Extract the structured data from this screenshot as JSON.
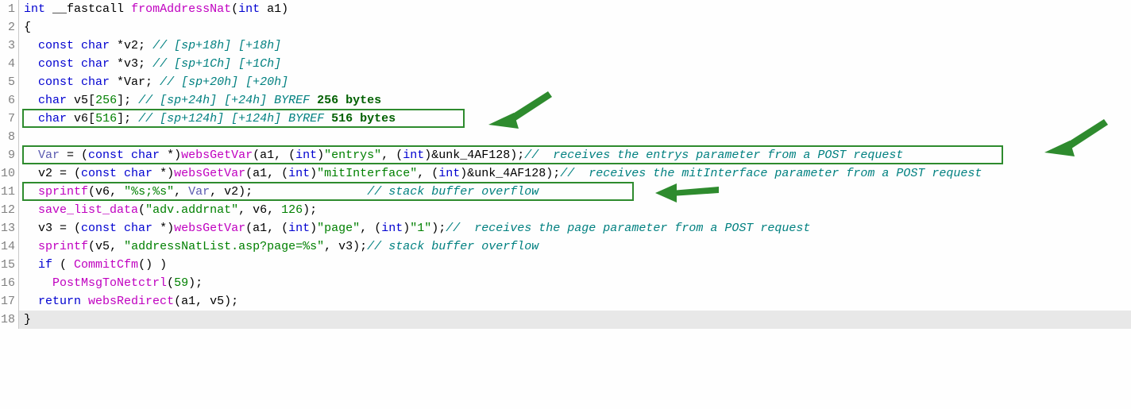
{
  "function_name": "fromAddressNat",
  "lines": [
    {
      "n": 1
    },
    {
      "n": 2
    },
    {
      "n": 3
    },
    {
      "n": 4
    },
    {
      "n": 5
    },
    {
      "n": 6,
      "bytes_comment": "256 bytes"
    },
    {
      "n": 7,
      "bytes_comment": "516 bytes"
    },
    {
      "n": 8
    },
    {
      "n": 9,
      "tail_comment": "receives the entrys parameter from a POST request"
    },
    {
      "n": 10,
      "tail_comment": "receives the mitInterface parameter from a POST request"
    },
    {
      "n": 11,
      "tail_comment": "stack buffer overflow"
    },
    {
      "n": 12
    },
    {
      "n": 13,
      "tail_comment": "receives the page parameter from a POST request"
    },
    {
      "n": 14,
      "tail_comment": "stack buffer overflow"
    },
    {
      "n": 15
    },
    {
      "n": 16
    },
    {
      "n": 17
    },
    {
      "n": 18
    }
  ],
  "code": {
    "l1_kw1": "int",
    "l1_cc": "__fastcall",
    "l1_fn": "fromAddressNat",
    "l1_kw2": "int",
    "l1_a": "a1",
    "l2": "{",
    "l3_kw": "const char",
    "l3_v": "*v2;",
    "l3_c": "// [sp+18h] [+18h]",
    "l4_kw": "const char",
    "l4_v": "*v3;",
    "l4_c": "// [sp+1Ch] [+1Ch]",
    "l5_kw": "const char",
    "l5_v": "*Var;",
    "l5_c": "// [sp+20h] [+20h]",
    "l6_kw": "char",
    "l6_v": "v5",
    "l6_sz": "256",
    "l6_c": "// [sp+24h] [+24h] BYREF",
    "l7_kw": "char",
    "l7_v": "v6",
    "l7_sz": "516",
    "l7_c": "// [sp+124h] [+124h] BYREF",
    "l9_lhs": "Var",
    "l9_cast": "const char",
    "l9_fn": "websGetVar",
    "l9_a1": "a1",
    "l9_kw": "int",
    "l9_s": "\"entrys\"",
    "l9_u": "unk_4AF128",
    "l10_lhs": "v2",
    "l10_cast": "const char",
    "l10_fn": "websGetVar",
    "l10_a1": "a1",
    "l10_kw": "int",
    "l10_s": "\"mitInterface\"",
    "l10_u": "unk_4AF128",
    "l11_fn": "sprintf",
    "l11_a": "v6",
    "l11_s": "\"%s;%s\"",
    "l11_b": "Var",
    "l11_c": "v2",
    "l12_fn": "save_list_data",
    "l12_s": "\"adv.addrnat\"",
    "l12_a": "v6",
    "l12_n": "126",
    "l13_lhs": "v3",
    "l13_cast": "const char",
    "l13_fn": "websGetVar",
    "l13_a1": "a1",
    "l13_kw": "int",
    "l13_s": "\"page\"",
    "l13_s2": "\"1\"",
    "l14_fn": "sprintf",
    "l14_a": "v5",
    "l14_s": "\"addressNatList.asp?page=%s\"",
    "l14_b": "v3",
    "l15_kw": "if",
    "l15_fn": "CommitCfm",
    "l16_fn": "PostMsgToNetctrl",
    "l16_n": "59",
    "l17_kw": "return",
    "l17_fn": "websRedirect",
    "l17_a": "a1",
    "l17_b": "v5",
    "l18": "}"
  }
}
